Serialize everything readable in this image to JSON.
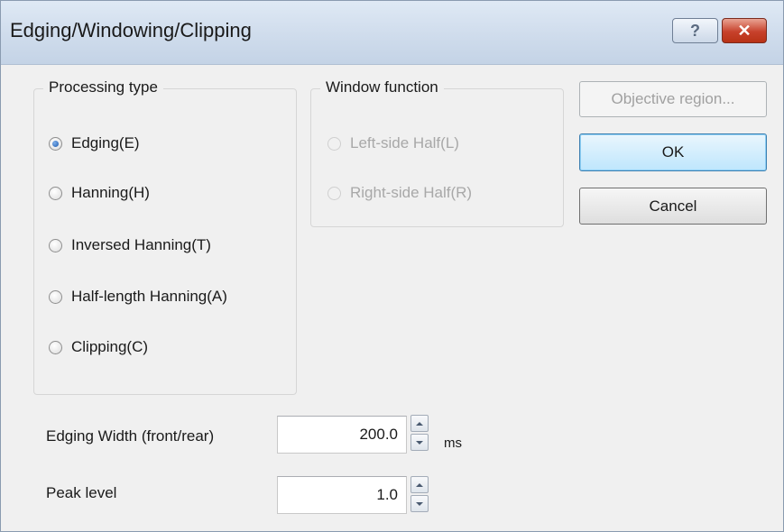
{
  "window": {
    "title": "Edging/Windowing/Clipping",
    "help_glyph": "?",
    "close_glyph": "✕"
  },
  "processing_type": {
    "label": "Processing type",
    "options": [
      {
        "label": "Edging(E)",
        "checked": true
      },
      {
        "label": "Hanning(H)",
        "checked": false
      },
      {
        "label": "Inversed Hanning(T)",
        "checked": false
      },
      {
        "label": "Half-length Hanning(A)",
        "checked": false
      },
      {
        "label": "Clipping(C)",
        "checked": false
      }
    ]
  },
  "window_function": {
    "label": "Window function",
    "enabled": false,
    "options": [
      {
        "label": "Left-side Half(L)",
        "checked": false
      },
      {
        "label": "Right-side Half(R)",
        "checked": false
      }
    ]
  },
  "buttons": {
    "objective_region": "Objective region...",
    "ok": "OK",
    "cancel": "Cancel"
  },
  "edging_width": {
    "label": "Edging Width (front/rear)",
    "value": "200.0",
    "unit": "ms"
  },
  "peak_level": {
    "label": "Peak level",
    "value": "1.0"
  },
  "colors": {
    "title_bar": "#cfdcec",
    "dialog_bg": "#f0f0f0",
    "close_button": "#c7412b",
    "default_button_border": "#3c7fb1"
  }
}
